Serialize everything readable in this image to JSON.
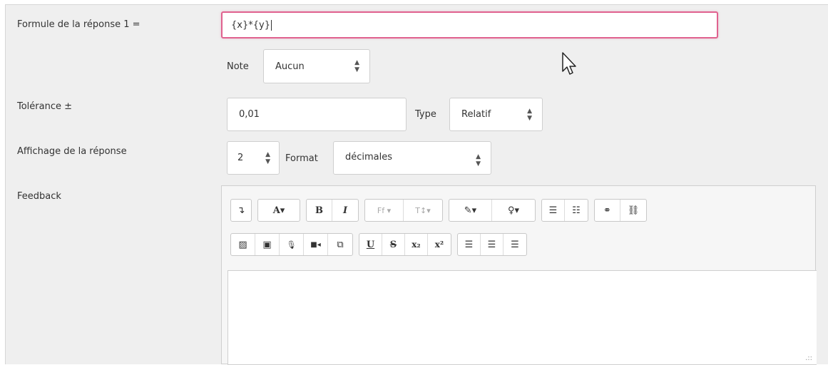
{
  "answer": {
    "formula_label": "Formule de la réponse 1 =",
    "formula_value": "{x}*{y}",
    "note_label": "Note",
    "note_value": "Aucun"
  },
  "tolerance": {
    "label": "Tolérance ±",
    "value": "0,01",
    "type_label": "Type",
    "type_value": "Relatif"
  },
  "display": {
    "label": "Affichage de la réponse",
    "digits_value": "2",
    "format_label": "Format",
    "format_value": "décimales"
  },
  "feedback": {
    "label": "Feedback",
    "toolbar_row1": [
      {
        "name": "show-more-icon",
        "glyph": "↴"
      },
      {
        "name": "text-style-icon",
        "glyph": "A▾"
      },
      {
        "name": "bold-icon",
        "glyph": "B"
      },
      {
        "name": "italic-icon",
        "glyph": "I"
      },
      {
        "name": "font-family-icon",
        "glyph": "Ff ▾"
      },
      {
        "name": "font-size-icon",
        "glyph": "T↕▾"
      },
      {
        "name": "text-color-icon",
        "glyph": "✎▾"
      },
      {
        "name": "highlight-icon",
        "glyph": "♀▾"
      },
      {
        "name": "bullet-list-icon",
        "glyph": "☰"
      },
      {
        "name": "numbered-list-icon",
        "glyph": "☷"
      },
      {
        "name": "link-icon",
        "glyph": "⚭"
      },
      {
        "name": "unlink-icon",
        "glyph": "⛓"
      }
    ],
    "toolbar_row2": [
      {
        "name": "insert-image-icon",
        "glyph": "▨"
      },
      {
        "name": "insert-media-icon",
        "glyph": "▣"
      },
      {
        "name": "record-audio-icon",
        "glyph": "🎙"
      },
      {
        "name": "record-video-icon",
        "glyph": "■◂"
      },
      {
        "name": "manage-files-icon",
        "glyph": "⧉"
      },
      {
        "name": "underline-icon",
        "glyph": "U"
      },
      {
        "name": "strikethrough-icon",
        "glyph": "S"
      },
      {
        "name": "subscript-icon",
        "glyph": "x₂"
      },
      {
        "name": "superscript-icon",
        "glyph": "x²"
      },
      {
        "name": "align-left-icon",
        "glyph": "☰"
      },
      {
        "name": "align-center-icon",
        "glyph": "☰"
      },
      {
        "name": "align-right-icon",
        "glyph": "☰"
      }
    ]
  },
  "colors": {
    "focus_border": "#e0628f",
    "panel_bg": "#efefef"
  }
}
